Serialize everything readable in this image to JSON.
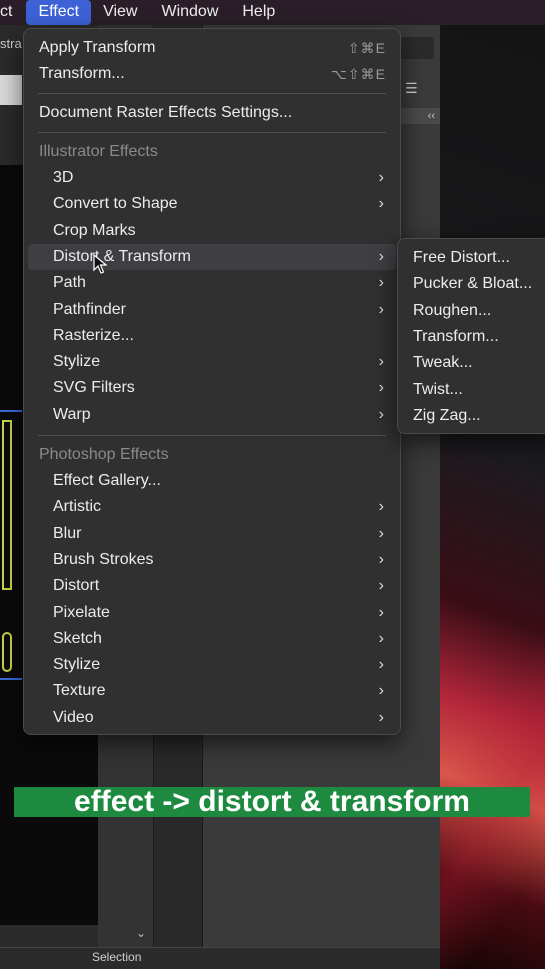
{
  "menubar": {
    "items": [
      "ct",
      "Effect",
      "View",
      "Window",
      "Help"
    ],
    "active": "Effect"
  },
  "background": {
    "doc_tab": "stra",
    "status_label": "Selection",
    "panel_collapse": "‹‹"
  },
  "effect_menu": {
    "apply_transform": {
      "label": "Apply Transform",
      "shortcut": "⇧⌘E"
    },
    "transform": {
      "label": "Transform...",
      "shortcut": "⌥⇧⌘E"
    },
    "raster_settings": "Document Raster Effects Settings...",
    "illustrator_header": "Illustrator Effects",
    "illustrator_items": [
      {
        "label": "3D",
        "submenu": true
      },
      {
        "label": "Convert to Shape",
        "submenu": true
      },
      {
        "label": "Crop Marks",
        "submenu": false
      },
      {
        "label": "Distort & Transform",
        "submenu": true,
        "highlighted": true
      },
      {
        "label": "Path",
        "submenu": true
      },
      {
        "label": "Pathfinder",
        "submenu": true
      },
      {
        "label": "Rasterize...",
        "submenu": false
      },
      {
        "label": "Stylize",
        "submenu": true
      },
      {
        "label": "SVG Filters",
        "submenu": true
      },
      {
        "label": "Warp",
        "submenu": true
      }
    ],
    "photoshop_header": "Photoshop Effects",
    "photoshop_items": [
      {
        "label": "Effect Gallery...",
        "submenu": false
      },
      {
        "label": "Artistic",
        "submenu": true
      },
      {
        "label": "Blur",
        "submenu": true
      },
      {
        "label": "Brush Strokes",
        "submenu": true
      },
      {
        "label": "Distort",
        "submenu": true
      },
      {
        "label": "Pixelate",
        "submenu": true
      },
      {
        "label": "Sketch",
        "submenu": true
      },
      {
        "label": "Stylize",
        "submenu": true
      },
      {
        "label": "Texture",
        "submenu": true
      },
      {
        "label": "Video",
        "submenu": true
      }
    ]
  },
  "distort_submenu": [
    "Free Distort...",
    "Pucker & Bloat...",
    "Roughen...",
    "Transform...",
    "Tweak...",
    "Twist...",
    "Zig Zag..."
  ],
  "caption": "effect -> distort & transform",
  "colors": {
    "highlight": "#3f3f43",
    "menubar_active": "#3d62d8",
    "caption_bg": "#1e8a40"
  },
  "icons": {
    "submenu_arrow": "›"
  }
}
